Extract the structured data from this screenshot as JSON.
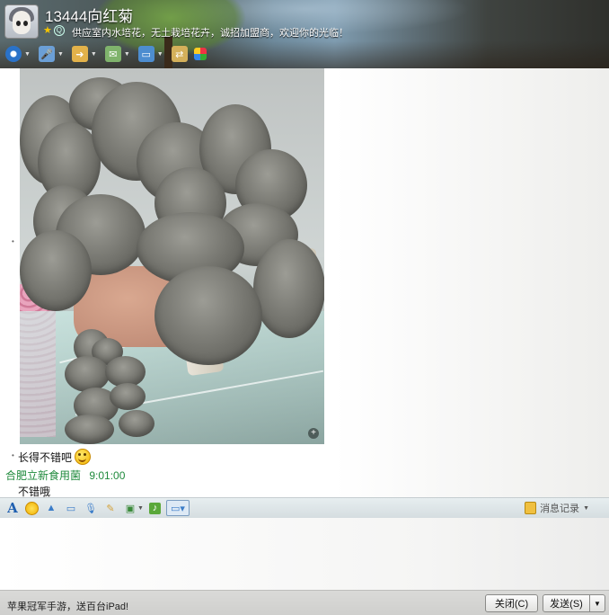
{
  "window": {
    "contact_name": "13444向红菊",
    "signature": "供应室内水培花，无土栽培花卉，诚招加盟商，欢迎你的光临！"
  },
  "header_icons": [
    "video-icon",
    "mic-icon",
    "folder-icon",
    "message-icon",
    "screen-icon",
    "transfer-icon",
    "apps-icon"
  ],
  "chat": {
    "image_alt": "平菇",
    "message1": "长得不错吧",
    "sender": "合肥立新食用菌",
    "time": "9:01:00",
    "message2": "不错哦"
  },
  "input_toolbar": {
    "history_label": "消息记录"
  },
  "bottom": {
    "ad_text": "苹果冠军手游，送百台iPad!",
    "close_label": "关闭(C)",
    "send_label": "发送(S)"
  },
  "colors": {
    "sender_green": "#1f8a3c",
    "font_icon_blue": "#1e5fb0"
  }
}
